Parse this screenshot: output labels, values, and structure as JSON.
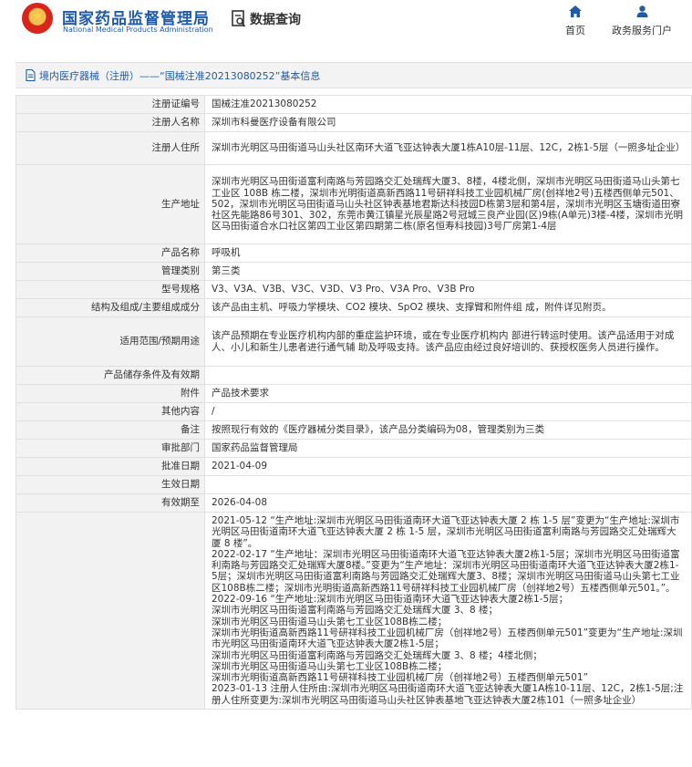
{
  "header": {
    "logo_cn": "国家药品监督管理局",
    "logo_en": "National Medical Products Administration",
    "data_query": "数据查询",
    "nav": {
      "home": "首页",
      "portal": "政务服务门户"
    },
    "brand_color": "#1f5ba8"
  },
  "title": "境内医疗器械（注册）——“国械注准20213080252”基本信息",
  "rows": [
    {
      "label": "注册证编号",
      "value": "国械注准20213080252"
    },
    {
      "label": "注册人名称",
      "value": "深圳市科曼医疗设备有限公司"
    },
    {
      "label": "注册人住所",
      "value": "深圳市光明区马田街道马山头社区南环大道飞亚达钟表大厦1栋A10层-11层、12C，2栋1-5层（一照多址企业）"
    },
    {
      "label": "生产地址",
      "value": "深圳市光明区马田街道富利南路与芳园路交汇处瑞辉大厦3、8楼，4楼北侧，深圳市光明区马田街道马山头第七工业区 108B 栋二楼，深圳市光明街道高新西路11号研祥科技工业园机械厂房(创祥地2号)五楼西侧单元501、502，深圳市光明区马田街道马山头社区钟表基地君斯达科技园D栋第3层和第4层，深圳市光明区玉塘街道田寮社区先能路86号301、302，东莞市黄江镇星光辰星路2号冠城三良产业园(区)9栋(A单元)3楼-4楼，深圳市光明区马田街道合水口社区第四工业区第四期第二栋(原名恒寿科技园)3号厂房第1-4层"
    },
    {
      "label": "产品名称",
      "value": "呼吸机"
    },
    {
      "label": "管理类别",
      "value": "第三类"
    },
    {
      "label": "型号规格",
      "value": "V3、V3A、V3B、V3C、V3D、V3 Pro、V3A Pro、V3B Pro"
    },
    {
      "label": "结构及组成/主要组成成分",
      "value": "该产品由主机、呼吸力学模块、CO2 模块、SpO2 模块、支撑臂和附件组 成，附件详见附页。"
    },
    {
      "label": "适用范围/预期用途",
      "value": "该产品预期在专业医疗机构内部的重症监护环境，或在专业医疗机构内 部进行转运时使用。该产品适用于对成人、小儿和新生儿患者进行通气辅 助及呼吸支持。该产品应由经过良好培训的、获授权医务人员进行操作。"
    },
    {
      "label": "产品储存条件及有效期",
      "value": ""
    },
    {
      "label": "附件",
      "value": "产品技术要求"
    },
    {
      "label": "其他内容",
      "value": "/"
    },
    {
      "label": "备注",
      "value": "按照现行有效的《医疗器械分类目录》，该产品分类编码为08，管理类别为三类"
    },
    {
      "label": "审批部门",
      "value": "国家药品监督管理局"
    },
    {
      "label": "批准日期",
      "value": "2021-04-09"
    },
    {
      "label": "生效日期",
      "value": ""
    },
    {
      "label": "有效期至",
      "value": "2026-04-08"
    }
  ],
  "changes": "2021-05-12 “生产地址:深圳市光明区马田街道南环大道飞亚达钟表大厦 2 栋 1-5 层”变更为“生产地址:深圳市光明区马田街道南环大道飞亚达钟表大厦 2 栋 1-5 层，深圳市光明区马田街道富利南路与芳园路交汇处瑞辉大厦 8 楼”。\n2022-02-17 “生产地址：深圳市光明区马田街道南环大道飞亚达钟表大厦2栋1-5层；深圳市光明区马田街道富利南路与芳园路交汇处瑞辉大厦8楼。”变更为“生产地址：深圳市光明区马田街道南环大道飞亚达钟表大厦2栋1-5层；深圳市光明区马田街道富利南路与芳园路交汇处瑞辉大厦3、8楼；深圳市光明区马田街道马山头第七工业区108B栋二楼；深圳市光明街道高新西路11号研祥科技工业园机械厂房（创祥地2号）五楼西侧单元501。”。\n2022-09-16 “生产地址:深圳市光明区马田街道南环大道飞亚达钟表大厦2栋1-5层；\n深圳市光明区马田街道富利南路与芳园路交汇处瑞辉大厦 3、8 楼；\n深圳市光明区马田街道马山头第七工业区108B栋二楼；\n深圳市光明街道高新西路11号研祥科技工业园机械厂房（创祥地2号）五楼西侧单元501”变更为“生产地址:深圳市光明区马田街道南环大道飞亚达钟表大厦2栋1-5层；\n深圳市光明区马田街道富利南路与芳园路交汇处瑞辉大厦 3、8 楼；4楼北侧；\n深圳市光明区马田街道马山头第七工业区108B栋二楼；\n深圳市光明街道高新西路11号研祥科技工业园机械厂房（创祥地2号）五楼西侧单元501”\n2023-01-13 注册人住所由:深圳市光明区马田街道南环大道飞亚达钟表大厦1A栋10-11层、12C，2栋1-5层;注册人住所变更为:深圳市光明区马田街道马山头社区钟表基地飞亚达钟表大厦2栋101（一照多址企业）"
}
